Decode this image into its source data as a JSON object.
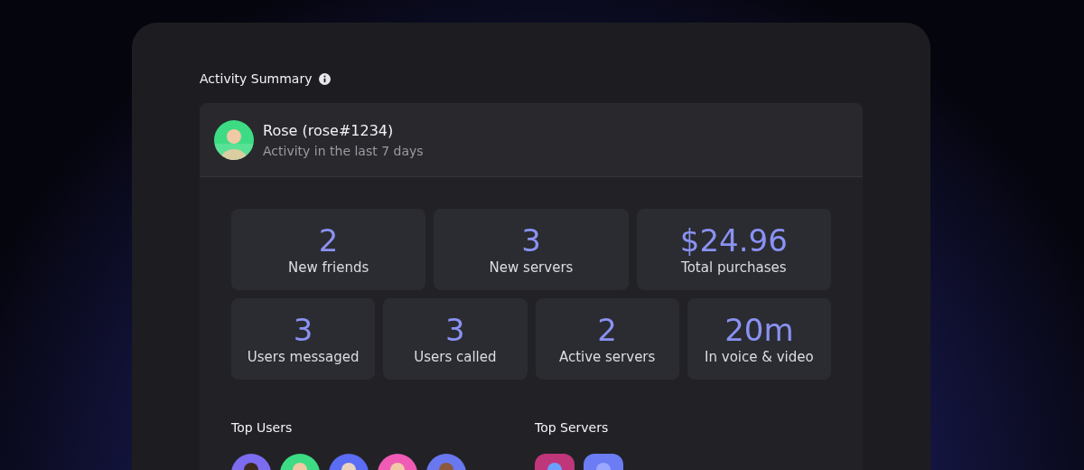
{
  "section_title": "Activity Summary",
  "profile": {
    "name": "Rose (rose#1234)",
    "subtitle": "Activity in the last 7 days"
  },
  "stat_rows": [
    [
      {
        "value": "2",
        "label": "New friends"
      },
      {
        "value": "3",
        "label": "New servers"
      },
      {
        "value": "$24.96",
        "label": "Total purchases"
      }
    ],
    [
      {
        "value": "3",
        "label": "Users messaged"
      },
      {
        "value": "3",
        "label": "Users called"
      },
      {
        "value": "2",
        "label": "Active servers"
      },
      {
        "value": "20m",
        "label": "In voice & video"
      }
    ]
  ],
  "top_users": {
    "title": "Top Users"
  },
  "top_servers": {
    "title": "Top Servers"
  }
}
